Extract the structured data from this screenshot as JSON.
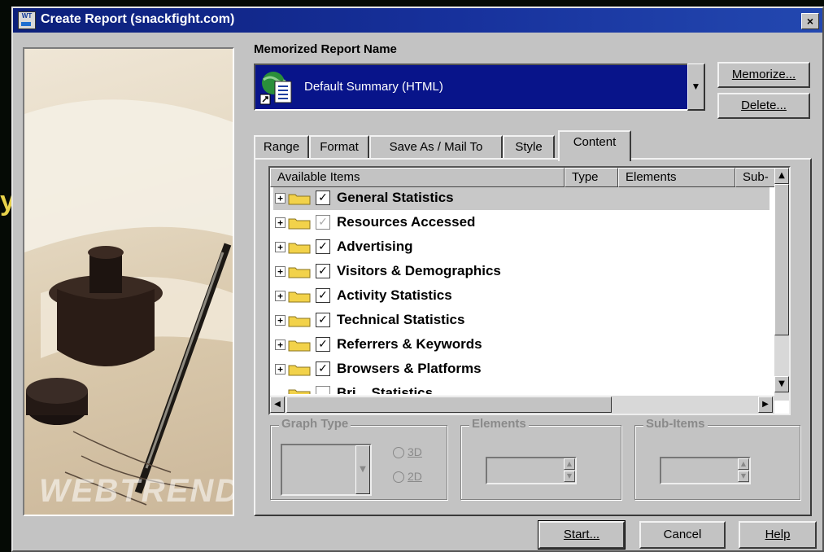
{
  "window": {
    "title": "Create Report (snackfight.com)",
    "close": "×"
  },
  "app_icon_text": "WT",
  "photo": {
    "watermark": "WEBTRENDS"
  },
  "memorized": {
    "label": "Memorized Report Name",
    "selected": "Default Summary (HTML)",
    "dropdown_arrow": "▼"
  },
  "buttons": {
    "memorize": "Memorize...",
    "delete": "Delete...",
    "start": "Start...",
    "cancel": "Cancel",
    "help": "Help"
  },
  "tabs": [
    "Range",
    "Format",
    "Save As / Mail To",
    "Style",
    "Content"
  ],
  "active_tab": "Content",
  "list": {
    "columns": [
      "Available Items",
      "Type",
      "Elements",
      "Sub-"
    ],
    "rows": [
      {
        "label": "General Statistics",
        "checked": true,
        "selected": true
      },
      {
        "label": "Resources Accessed",
        "checked": true,
        "grayed": true
      },
      {
        "label": "Advertising",
        "checked": true
      },
      {
        "label": "Visitors & Demographics",
        "checked": true
      },
      {
        "label": "Activity Statistics",
        "checked": true
      },
      {
        "label": "Technical Statistics",
        "checked": true
      },
      {
        "label": "Referrers & Keywords",
        "checked": true
      },
      {
        "label": "Browsers & Platforms",
        "checked": true
      },
      {
        "label": "Bri... Statistics",
        "checked": false,
        "partial": true
      }
    ],
    "expand_glyph": "+",
    "check_glyph": "✓"
  },
  "graph_type": {
    "label": "Graph Type",
    "options": [
      "3D",
      "2D"
    ]
  },
  "elements_group": {
    "label": "Elements"
  },
  "subitems_group": {
    "label": "Sub-Items"
  },
  "scroll": {
    "up": "▲",
    "down": "▼",
    "left": "◀",
    "right": "▶"
  },
  "colors": {
    "title_bar": "#0c1f7a",
    "selection": "#08148a",
    "dialog": "#c3c3c3"
  }
}
